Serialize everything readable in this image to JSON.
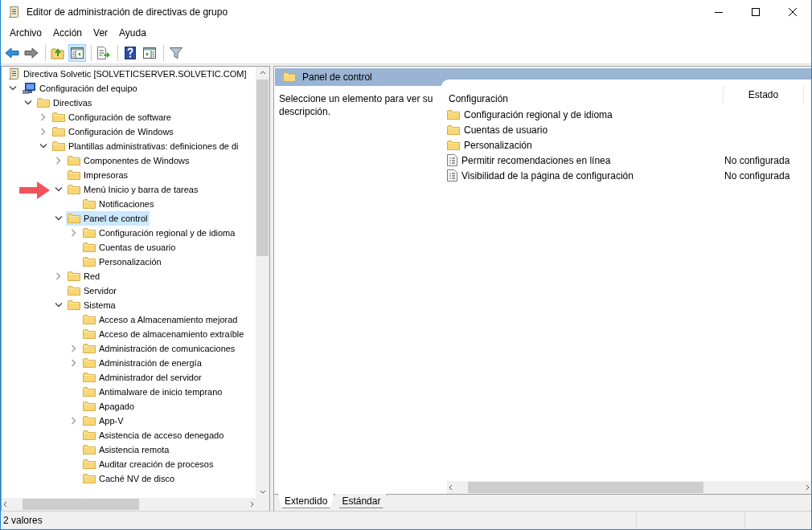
{
  "window": {
    "title": "Editor de administración de directivas de grupo"
  },
  "menu": [
    "Archivo",
    "Acción",
    "Ver",
    "Ayuda"
  ],
  "toolbar": [
    {
      "kind": "back",
      "pressed": false
    },
    {
      "kind": "forward",
      "pressed": false
    },
    {
      "kind": "separator"
    },
    {
      "kind": "up",
      "pressed": false
    },
    {
      "kind": "tree-toggle",
      "pressed": true
    },
    {
      "kind": "separator"
    },
    {
      "kind": "export",
      "pressed": false
    },
    {
      "kind": "separator"
    },
    {
      "kind": "help",
      "pressed": false
    },
    {
      "kind": "action-pane",
      "pressed": false
    },
    {
      "kind": "separator"
    },
    {
      "kind": "filter",
      "pressed": false
    }
  ],
  "tree": {
    "items": [
      {
        "label": "Directiva Solvetic [SOLVETICSERVER.SOLVETIC.COM]",
        "kind": "policy",
        "selected": false,
        "children": [
          {
            "label": "Configuración del equipo",
            "kind": "computer",
            "expanded": true,
            "selected": false,
            "children": [
              {
                "label": "Directivas",
                "kind": "folder",
                "expanded": true,
                "selected": false,
                "children": [
                  {
                    "label": "Configuración de software",
                    "kind": "folder",
                    "expanded": false,
                    "selected": false
                  },
                  {
                    "label": "Configuración de Windows",
                    "kind": "folder",
                    "expanded": false,
                    "selected": false
                  },
                  {
                    "label": "Plantillas administrativas: definiciones de di",
                    "kind": "folder",
                    "expanded": true,
                    "selected": false,
                    "children": [
                      {
                        "label": "Componentes de Windows",
                        "kind": "folder",
                        "expanded": false,
                        "selected": false
                      },
                      {
                        "label": "Impresoras",
                        "kind": "folder",
                        "selected": false
                      },
                      {
                        "label": "Menú Inicio y barra de tareas",
                        "kind": "folder",
                        "expanded": true,
                        "selected": false,
                        "children": [
                          {
                            "label": "Notificaciones",
                            "kind": "folder",
                            "selected": false
                          }
                        ]
                      },
                      {
                        "label": "Panel de control",
                        "kind": "folder",
                        "expanded": true,
                        "selected": true,
                        "children": [
                          {
                            "label": "Configuración regional y de idioma",
                            "kind": "folder",
                            "expanded": false,
                            "selected": false
                          },
                          {
                            "label": "Cuentas de usuario",
                            "kind": "folder",
                            "selected": false
                          },
                          {
                            "label": "Personalización",
                            "kind": "folder",
                            "selected": false
                          }
                        ]
                      },
                      {
                        "label": "Red",
                        "kind": "folder",
                        "expanded": false,
                        "selected": false
                      },
                      {
                        "label": "Servidor",
                        "kind": "folder",
                        "selected": false
                      },
                      {
                        "label": "Sistema",
                        "kind": "folder",
                        "expanded": true,
                        "selected": false,
                        "children": [
                          {
                            "label": "Acceso a Almacenamiento mejorad",
                            "kind": "folder",
                            "selected": false
                          },
                          {
                            "label": "Acceso de almacenamiento extraíble",
                            "kind": "folder",
                            "selected": false
                          },
                          {
                            "label": "Administración de comunicaciones",
                            "kind": "folder",
                            "expanded": false,
                            "selected": false
                          },
                          {
                            "label": "Administración de energía",
                            "kind": "folder",
                            "expanded": false,
                            "selected": false
                          },
                          {
                            "label": "Administrador del servidor",
                            "kind": "folder",
                            "selected": false
                          },
                          {
                            "label": "Antimalware de inicio temprano",
                            "kind": "folder",
                            "selected": false
                          },
                          {
                            "label": "Apagado",
                            "kind": "folder",
                            "selected": false
                          },
                          {
                            "label": "App-V",
                            "kind": "folder",
                            "expanded": false,
                            "selected": false
                          },
                          {
                            "label": "Asistencia de acceso denegado",
                            "kind": "folder",
                            "selected": false
                          },
                          {
                            "label": "Asistencia remota",
                            "kind": "folder",
                            "selected": false
                          },
                          {
                            "label": "Auditar creación de procesos",
                            "kind": "folder",
                            "selected": false
                          },
                          {
                            "label": "Caché NV de disco",
                            "kind": "folder",
                            "selected": false
                          }
                        ]
                      }
                    ]
                  }
                ]
              }
            ]
          }
        ]
      }
    ]
  },
  "details": {
    "header": "Panel de control",
    "description": "Seleccione un elemento para ver su descripción.",
    "columns": [
      "Configuración",
      "Estado"
    ],
    "rows": [
      {
        "kind": "folder",
        "name": "Configuración regional y de idioma"
      },
      {
        "kind": "folder",
        "name": "Cuentas de usuario"
      },
      {
        "kind": "folder",
        "name": "Personalización"
      },
      {
        "kind": "setting",
        "name": "Permitir recomendaciones en línea",
        "state": "No configurada"
      },
      {
        "kind": "setting",
        "name": "Visibilidad de la página de configuración",
        "state": "No configurada"
      }
    ],
    "tabs": [
      {
        "label": "Extendido",
        "selected": true
      },
      {
        "label": "Estándar",
        "selected": false
      }
    ]
  },
  "status_bar": "2 valores"
}
